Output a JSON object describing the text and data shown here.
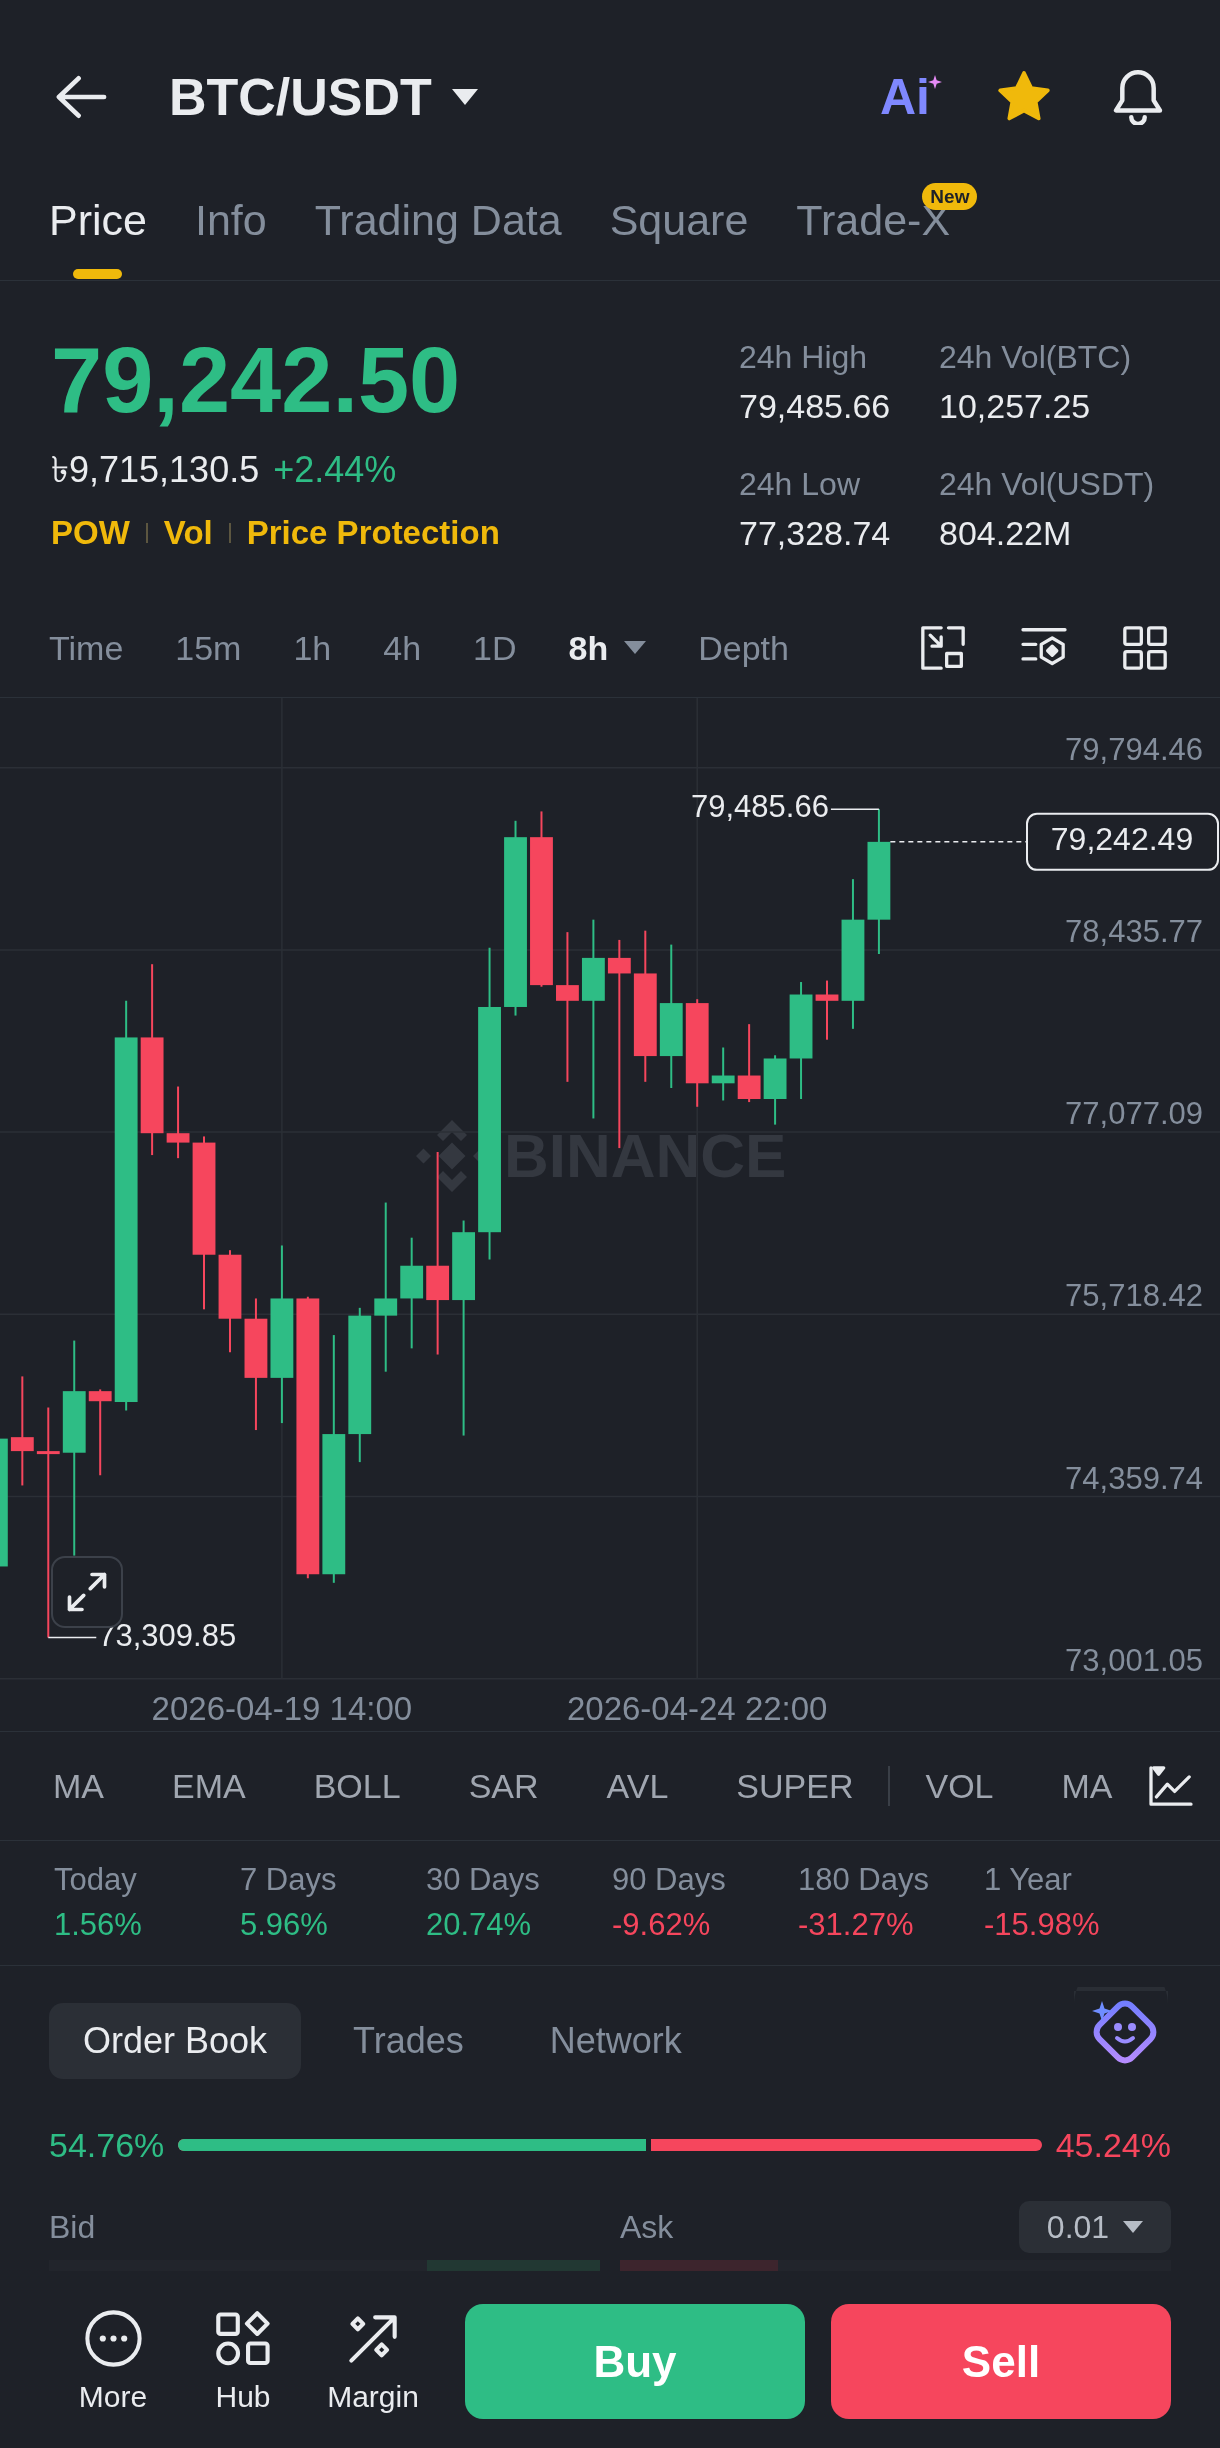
{
  "header": {
    "pair": "BTC/USDT",
    "ai_label": "Ai",
    "favorited": true
  },
  "tabs": [
    {
      "label": "Price",
      "selected": true
    },
    {
      "label": "Info",
      "selected": false
    },
    {
      "label": "Trading Data",
      "selected": false
    },
    {
      "label": "Square",
      "selected": false
    },
    {
      "label": "Trade-X",
      "selected": false,
      "badge": "New"
    }
  ],
  "price": {
    "last": "79,242.50",
    "color": "#2ebd85",
    "local_price": "৳9,715,130.5",
    "change": "+2.44%",
    "tags": [
      "POW",
      "Vol",
      "Price Protection"
    ]
  },
  "stats": [
    {
      "label": "24h High",
      "value": "79,485.66"
    },
    {
      "label": "24h Vol(BTC)",
      "value": "10,257.25"
    },
    {
      "label": "24h Low",
      "value": "77,328.74"
    },
    {
      "label": "24h Vol(USDT)",
      "value": "804.22M"
    }
  ],
  "intervals": [
    {
      "label": "Time",
      "selected": false,
      "dropdown": false
    },
    {
      "label": "15m",
      "selected": false,
      "dropdown": false
    },
    {
      "label": "1h",
      "selected": false,
      "dropdown": false
    },
    {
      "label": "4h",
      "selected": false,
      "dropdown": false
    },
    {
      "label": "1D",
      "selected": false,
      "dropdown": false
    },
    {
      "label": "8h",
      "selected": true,
      "dropdown": true
    },
    {
      "label": "Depth",
      "selected": false,
      "dropdown": false
    }
  ],
  "chart": {
    "watermark": "BINANCE",
    "y_axis_labels": [
      "79,794.46",
      "78,435.77",
      "77,077.09",
      "75,718.42",
      "74,359.74",
      "73,001.05"
    ],
    "x_axis_labels": [
      "2026-04-19 14:00",
      "2026-04-24 22:00"
    ],
    "high_label": "79,485.66",
    "low_label": "73,309.85",
    "last_price_tag": "79,242.49"
  },
  "indicators": {
    "main": [
      "MA",
      "EMA",
      "BOLL",
      "SAR",
      "AVL",
      "SUPER"
    ],
    "sub": [
      "VOL",
      "MA"
    ]
  },
  "performance": [
    {
      "period": "Today",
      "change": "1.56%",
      "color": "#2ebd85"
    },
    {
      "period": "7 Days",
      "change": "5.96%",
      "color": "#2ebd85"
    },
    {
      "period": "30 Days",
      "change": "20.74%",
      "color": "#2ebd85"
    },
    {
      "period": "90 Days",
      "change": "-9.62%",
      "color": "#f6465d"
    },
    {
      "period": "180 Days",
      "change": "-31.27%",
      "color": "#f6465d"
    },
    {
      "period": "1 Year",
      "change": "-15.98%",
      "color": "#f6465d"
    }
  ],
  "order_book": {
    "tabs": [
      {
        "label": "Order Book",
        "selected": true
      },
      {
        "label": "Trades",
        "selected": false
      },
      {
        "label": "Network",
        "selected": false
      }
    ],
    "ratio": {
      "bid": "54.76%",
      "ask": "45.24%",
      "level": 0.5476
    },
    "columns": {
      "bid": "Bid",
      "ask": "Ask"
    },
    "precision": "0.01",
    "depth_bars": {
      "bid": {
        "level": 0.314
      },
      "ask": {
        "level": 0.287
      }
    }
  },
  "bottom_bar": {
    "nav": [
      {
        "label": "More"
      },
      {
        "label": "Hub"
      },
      {
        "label": "Margin"
      }
    ],
    "buy": "Buy",
    "sell": "Sell"
  }
}
